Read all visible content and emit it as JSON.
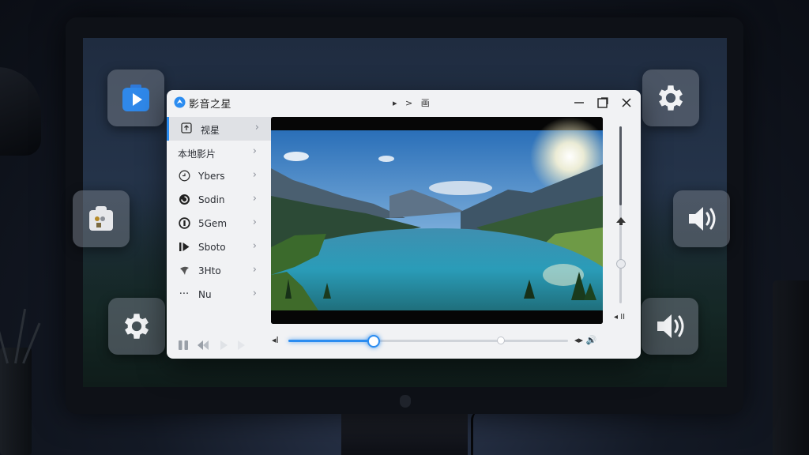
{
  "window": {
    "app_title": "影音之星",
    "title_controls": [
      "▸",
      ">",
      "画"
    ],
    "minimize_glyph": "—",
    "close_glyph": "✕"
  },
  "sidebar": {
    "items": [
      {
        "label": "视星",
        "icon": "upload-icon",
        "active": true
      },
      {
        "label": "本地影片",
        "icon": "",
        "active": false
      },
      {
        "label": "Ybers",
        "icon": "clock-icon",
        "active": false
      },
      {
        "label": "Sodin",
        "icon": "spiral-icon",
        "active": false
      },
      {
        "label": "5Gem",
        "icon": "target-icon",
        "active": false
      },
      {
        "label": "Sboto",
        "icon": "play-bar-icon",
        "active": false
      },
      {
        "label": "3Hto",
        "icon": "leaf-icon",
        "active": false
      },
      {
        "label": "Nu",
        "icon": "more-icon",
        "active": false
      }
    ],
    "bottom_controls": [
      "pause-icon",
      "rewind-icon",
      "play-icon",
      "forward-icon"
    ]
  },
  "player": {
    "prev_label": "◂I",
    "right_controls": "◂▸ 🔊",
    "volume_bottom": "◂ II",
    "progress": 0.3,
    "buffered": 0.75,
    "volume": 0.45
  },
  "desktop_tiles": {
    "left": [
      "video-app-icon",
      "puzzle-icon",
      "gear-icon"
    ],
    "right": [
      "gear-icon",
      "speaker-icon",
      "speaker-icon"
    ]
  },
  "colors": {
    "accent": "#2b8cf0",
    "window_bg": "#f1f2f4",
    "tile_bg": "#70768a"
  }
}
